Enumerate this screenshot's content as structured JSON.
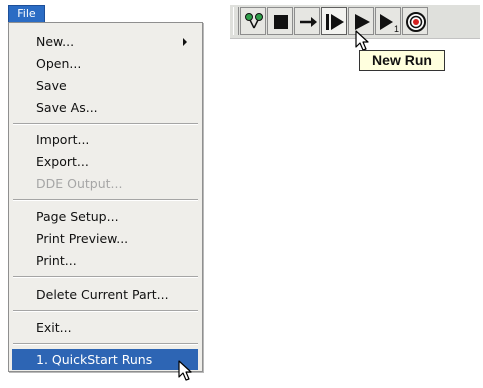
{
  "menu": {
    "title": "File",
    "items": [
      {
        "label": "New..."
      },
      {
        "label": "Open..."
      },
      {
        "label": "Save"
      },
      {
        "label": "Save As..."
      },
      {
        "label": "Import..."
      },
      {
        "label": "Export..."
      },
      {
        "label": "DDE Output..."
      },
      {
        "label": "Page Setup..."
      },
      {
        "label": "Print Preview..."
      },
      {
        "label": "Print..."
      },
      {
        "label": "Delete Current Part..."
      },
      {
        "label": "Exit..."
      },
      {
        "label": "1. QuickStart Runs"
      }
    ],
    "selected_color": "#2d65b4"
  },
  "toolbar": {
    "tooltip": "New Run",
    "buttons": [
      {
        "icon": "branch-icon"
      },
      {
        "icon": "stop-icon"
      },
      {
        "icon": "arrow-right-icon"
      },
      {
        "icon": "new-run-icon"
      },
      {
        "icon": "play-icon"
      },
      {
        "icon": "play-one-icon"
      },
      {
        "icon": "target-icon"
      }
    ],
    "play_one_subscript": "1"
  }
}
